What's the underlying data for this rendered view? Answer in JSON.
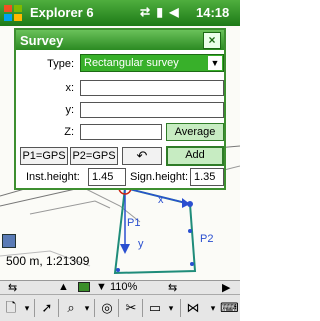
{
  "titlebar": {
    "app_title": "Explorer 6",
    "clock": "14:18",
    "icons": [
      "windows-flag-icon",
      "connectivity-icon",
      "signal-icon",
      "volume-icon"
    ]
  },
  "dialog": {
    "title": "Survey",
    "close": "×",
    "type_label": "Type:",
    "type_value": "Rectangular survey",
    "x_label": "x:",
    "y_label": "y:",
    "z_label": "Z:",
    "average_label": "Average",
    "p1_label": "P1=GPS",
    "p2_label": "P2=GPS",
    "undo_icon": "undo-icon",
    "add_label": "Add",
    "inst_height_label": "Inst.height:",
    "inst_height_value": "1.45",
    "sign_height_label": "Sign.height:",
    "sign_height_value": "1.35"
  },
  "map": {
    "scale_text": "500 m, 1:21309",
    "p1_label": "P1",
    "p2_label": "P2",
    "x_axis_label": "x",
    "y_axis_label": "y"
  },
  "statusbar": {
    "zoom_text": "110%"
  },
  "colors": {
    "title_green": "#1d7a17",
    "accent_green": "#38b02a",
    "survey_blue": "#2a4fd0",
    "path_teal": "#1f8c7a"
  }
}
